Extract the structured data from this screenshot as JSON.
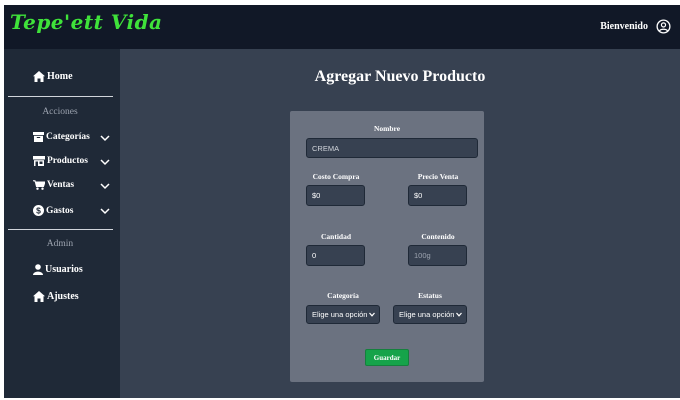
{
  "header": {
    "brand": "Tepe'ett Vida",
    "welcome": "Bienvenido",
    "colors": {
      "background": "#111827",
      "brand": "#3fe23a"
    }
  },
  "sidebar": {
    "home": {
      "label": "Home",
      "icon": "home-icon"
    },
    "actions_title": "Acciones",
    "actions": [
      {
        "label": "Categorías",
        "icon": "archive-icon"
      },
      {
        "label": "Productos",
        "icon": "store-icon"
      },
      {
        "label": "Ventas",
        "icon": "cart-icon"
      },
      {
        "label": "Gastos",
        "icon": "dollar-icon"
      }
    ],
    "admin_title": "Admin",
    "admin": [
      {
        "label": "Usuarios",
        "icon": "user-icon"
      },
      {
        "label": "Ajustes",
        "icon": "home-icon"
      }
    ]
  },
  "main": {
    "title": "Agregar Nuevo Producto",
    "form": {
      "nombre_label": "Nombre",
      "nombre_value": "CREMA",
      "costo_label": "Costo Compra",
      "costo_value": "$0",
      "precio_label": "Precio Venta",
      "precio_value": "$0",
      "cantidad_label": "Cantidad",
      "cantidad_value": "0",
      "contenido_label": "Contenido",
      "contenido_placeholder": "100g",
      "categoria_label": "Categoría",
      "categoria_selected": "Elige una opción",
      "estatus_label": "Estatus",
      "estatus_selected": "Elige una opción",
      "save_label": "Guardar"
    },
    "colors": {
      "card": "#6b7280",
      "button": "#16a34a"
    }
  }
}
